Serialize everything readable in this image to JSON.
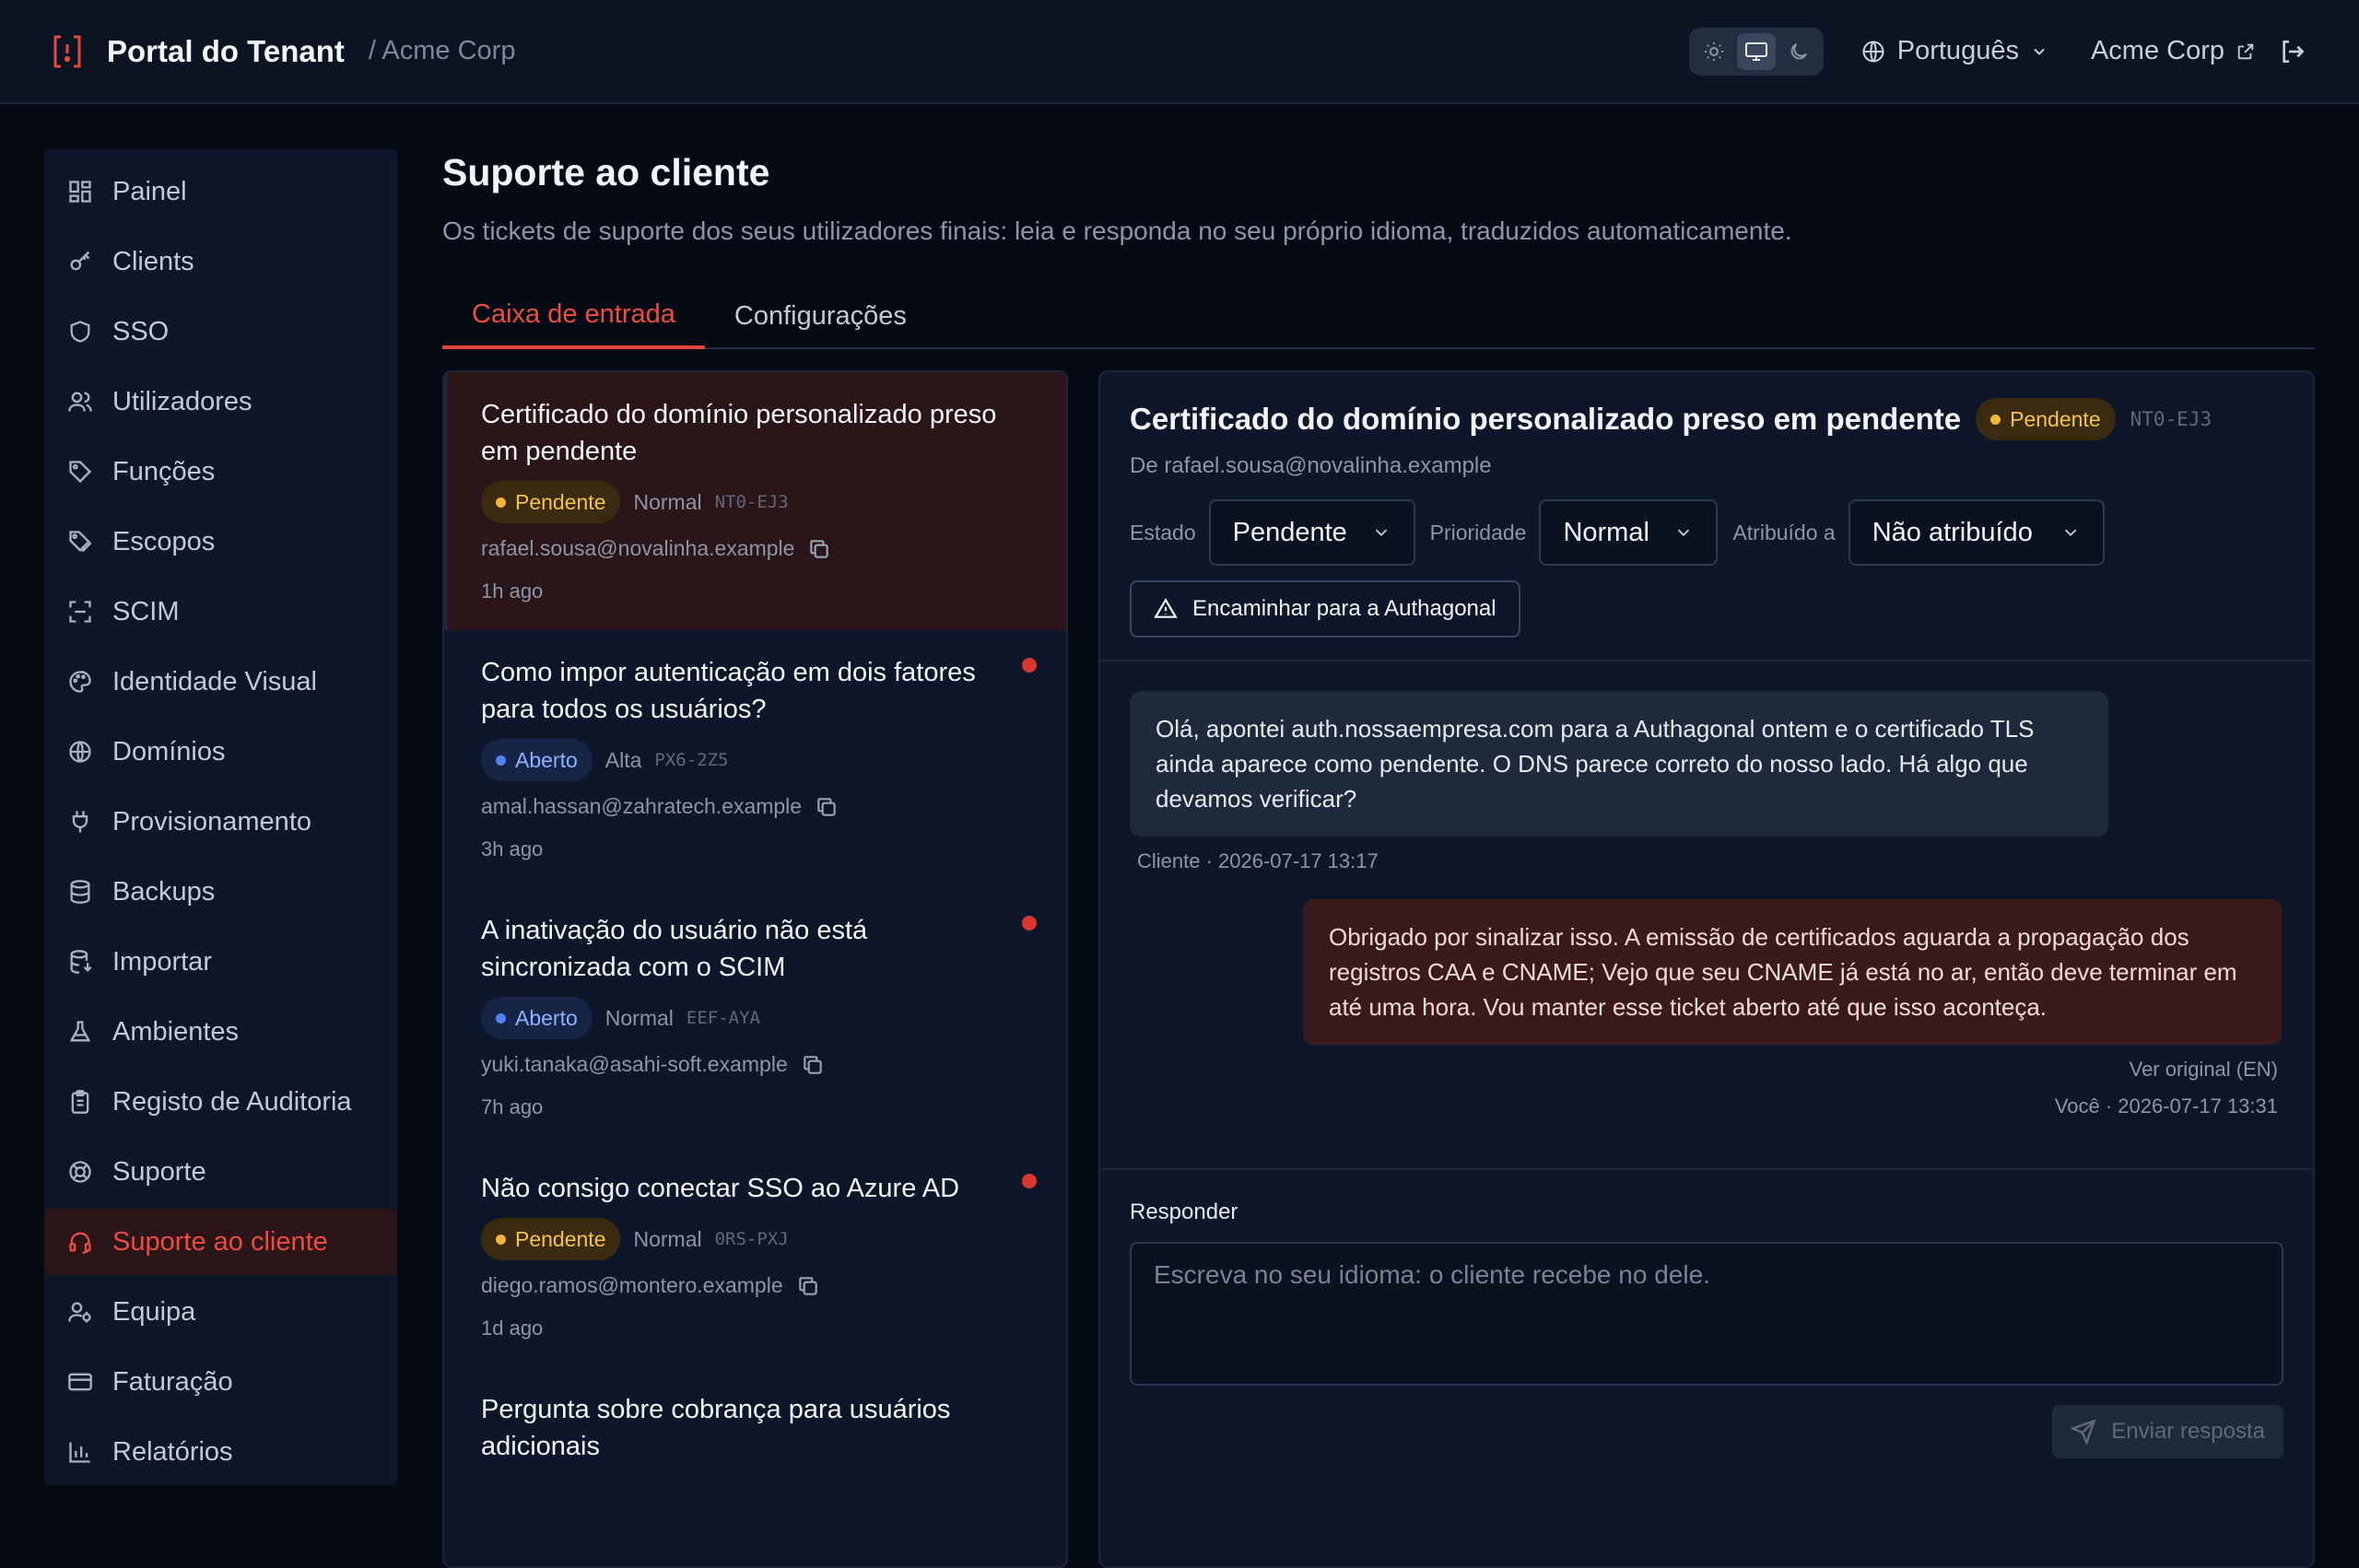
{
  "header": {
    "brand": "Portal do Tenant",
    "crumb": "/ Acme Corp",
    "language": "Português",
    "org_link": "Acme Corp",
    "theme_active": "system"
  },
  "sidebar": {
    "items": [
      {
        "label": "Painel",
        "icon": "dashboard-icon"
      },
      {
        "label": "Clients",
        "icon": "key-icon"
      },
      {
        "label": "SSO",
        "icon": "shield-icon"
      },
      {
        "label": "Utilizadores",
        "icon": "users-icon"
      },
      {
        "label": "Funções",
        "icon": "tag-icon"
      },
      {
        "label": "Escopos",
        "icon": "tags-icon"
      },
      {
        "label": "SCIM",
        "icon": "scan-icon"
      },
      {
        "label": "Identidade Visual",
        "icon": "palette-icon"
      },
      {
        "label": "Domínios",
        "icon": "globe-icon"
      },
      {
        "label": "Provisionamento",
        "icon": "plug-icon"
      },
      {
        "label": "Backups",
        "icon": "database-icon"
      },
      {
        "label": "Importar",
        "icon": "database-import-icon"
      },
      {
        "label": "Ambientes",
        "icon": "flask-icon"
      },
      {
        "label": "Registo de Auditoria",
        "icon": "clipboard-icon"
      },
      {
        "label": "Suporte",
        "icon": "lifebuoy-icon"
      },
      {
        "label": "Suporte ao cliente",
        "icon": "headset-icon"
      },
      {
        "label": "Equipa",
        "icon": "team-icon"
      },
      {
        "label": "Faturação",
        "icon": "credit-card-icon"
      },
      {
        "label": "Relatórios",
        "icon": "bar-chart-icon"
      }
    ],
    "active_index": 15
  },
  "page": {
    "title": "Suporte ao cliente",
    "subtitle": "Os tickets de suporte dos seus utilizadores finais: leia e responda no seu próprio idioma, traduzidos automaticamente.",
    "tabs": [
      "Caixa de entrada",
      "Configurações"
    ]
  },
  "tickets": [
    {
      "title": "Certificado do domínio personalizado preso em pendente",
      "status": "Pendente",
      "priority": "Normal",
      "code": "NT0-EJ3",
      "email": "rafael.sousa@novalinha.example",
      "ago": "1h ago"
    },
    {
      "title": "Como impor autenticação em dois fatores para todos os usuários?",
      "status": "Aberto",
      "priority": "Alta",
      "code": "PX6-2Z5",
      "email": "amal.hassan@zahratech.example",
      "ago": "3h ago"
    },
    {
      "title": "A inativação do usuário não está sincronizada com o SCIM",
      "status": "Aberto",
      "priority": "Normal",
      "code": "EEF-AYA",
      "email": "yuki.tanaka@asahi-soft.example",
      "ago": "7h ago"
    },
    {
      "title": "Não consigo conectar SSO ao Azure AD",
      "status": "Pendente",
      "priority": "Normal",
      "code": "0RS-PXJ",
      "email": "diego.ramos@montero.example",
      "ago": "1d ago"
    },
    {
      "title": "Pergunta sobre cobrança para usuários adicionais",
      "status": "",
      "priority": "",
      "code": "",
      "email": "",
      "ago": ""
    }
  ],
  "detail": {
    "title": "Certificado do domínio personalizado preso em pendente",
    "status": "Pendente",
    "code": "NT0-EJ3",
    "from": "De rafael.sousa@novalinha.example",
    "labels": {
      "status": "Estado",
      "priority": "Prioridade",
      "assigned": "Atribuído a"
    },
    "values": {
      "status": "Pendente",
      "priority": "Normal",
      "assigned": "Não atribuído"
    },
    "escalate": "Encaminhar para a Authagonal",
    "messages": {
      "incoming": "Olá, apontei auth.nossaempresa.com para a Authagonal ontem e o certificado TLS ainda aparece como pendente. O DNS parece correto do nosso lado. Há algo que devamos verificar?",
      "incoming_meta": "Cliente · 2026-07-17 13:17",
      "outgoing": "Obrigado por sinalizar isso. A emissão de certificados aguarda a propagação dos registros CAA e CNAME; Vejo que seu CNAME já está no ar, então deve terminar em até uma hora. Vou manter esse ticket aberto até que isso aconteça.",
      "original_link": "Ver original (EN)",
      "outgoing_meta": "Você · 2026-07-17 13:31"
    },
    "reply": {
      "label": "Responder",
      "placeholder": "Escreva no seu idioma: o cliente recebe no dele.",
      "send": "Enviar resposta"
    }
  },
  "colors": {
    "accent": "#e5483f",
    "pending": "#f2b53b",
    "open": "#4f83f7",
    "unread": "#d9372f"
  }
}
